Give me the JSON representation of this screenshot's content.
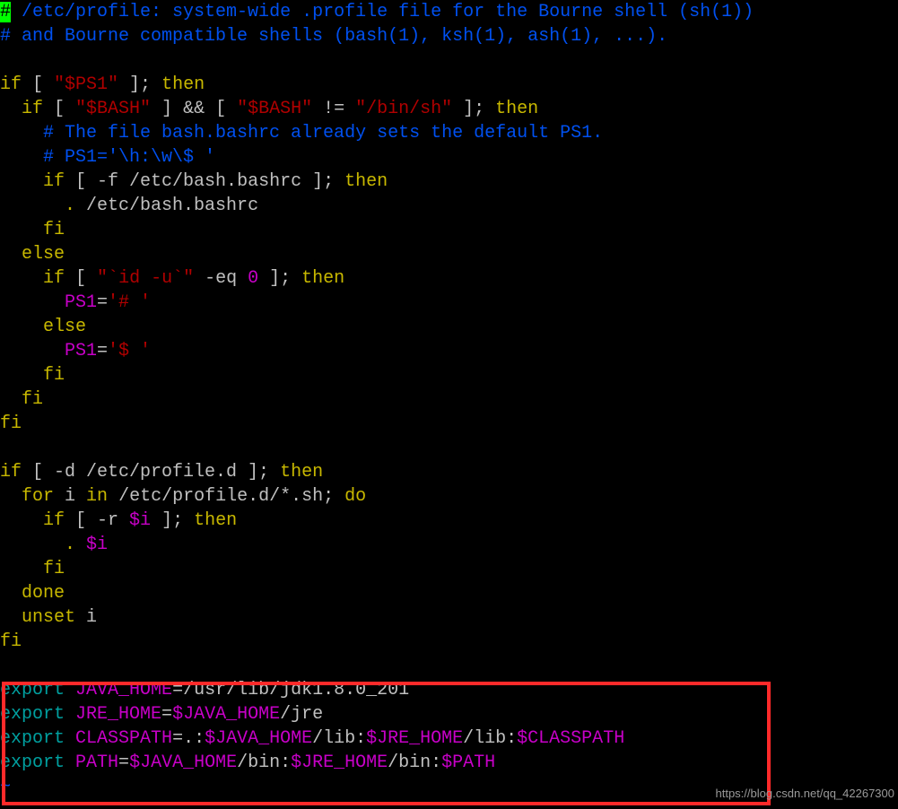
{
  "lines": {
    "l1_hash": "#",
    "l1_rest": " /etc/profile: system-wide .profile file for the Bourne shell (sh(1))",
    "l2": "# and Bourne compatible shells (bash(1), ksh(1), ash(1), ...).",
    "l3": "",
    "l4_if": "if",
    "l4_a": " [ ",
    "l4_ps1": "\"$PS1\"",
    "l4_b": " ]; ",
    "l4_then": "then",
    "l5_pad": "  ",
    "l5_if": "if",
    "l5_a": " [ ",
    "l5_bash1": "\"$BASH\"",
    "l5_b": " ] && [ ",
    "l5_bash2": "\"$BASH\"",
    "l5_c": " != ",
    "l5_binsh": "\"/bin/sh\"",
    "l5_d": " ]; ",
    "l5_then": "then",
    "l6": "    # The file bash.bashrc already sets the default PS1.",
    "l7": "    # PS1='\\h:\\w\\$ '",
    "l8_pad": "    ",
    "l8_if": "if",
    "l8_a": " [ -f /etc/bash.bashrc ]; ",
    "l8_then": "then",
    "l9_pad": "      ",
    "l9_dot": ".",
    "l9_a": " /etc/bash.bashrc",
    "l10_pad": "    ",
    "l10_fi": "fi",
    "l11_pad": "  ",
    "l11_else": "else",
    "l12_pad": "    ",
    "l12_if": "if",
    "l12_a": " [ ",
    "l12_q1": "\"",
    "l12_id": "`id -u`",
    "l12_q2": "\"",
    "l12_b": " -eq ",
    "l12_num": "0",
    "l12_c": " ]; ",
    "l12_then": "then",
    "l13_pad": "      ",
    "l13_ps1": "PS1",
    "l13_eq": "=",
    "l13_val": "'# '",
    "l14_pad": "    ",
    "l14_else": "else",
    "l15_pad": "      ",
    "l15_ps1": "PS1",
    "l15_eq": "=",
    "l15_val": "'$ '",
    "l16_pad": "    ",
    "l16_fi": "fi",
    "l17_pad": "  ",
    "l17_fi": "fi",
    "l18_fi": "fi",
    "l19": "",
    "l20_if": "if",
    "l20_a": " [ -d /etc/profile.d ]; ",
    "l20_then": "then",
    "l21_pad": "  ",
    "l21_for": "for",
    "l21_a": " i ",
    "l21_in": "in",
    "l21_b": " /etc/profile.d/*.sh; ",
    "l21_do": "do",
    "l22_pad": "    ",
    "l22_if": "if",
    "l22_a": " [ -r ",
    "l22_i": "$i",
    "l22_b": " ]; ",
    "l22_then": "then",
    "l23_pad": "      ",
    "l23_dot": ".",
    "l23_sp": " ",
    "l23_i": "$i",
    "l24_pad": "    ",
    "l24_fi": "fi",
    "l25_pad": "  ",
    "l25_done": "done",
    "l26_pad": "  ",
    "l26_unset": "unset",
    "l26_a": " i",
    "l27_fi": "fi",
    "l28": "",
    "l29_exp": "export",
    "l29_a": " ",
    "l29_var": "JAVA_HOME",
    "l29_eq": "=/usr/lib/jdk1.8.0_201",
    "l30_exp": "export",
    "l30_a": " ",
    "l30_var": "JRE_HOME",
    "l30_eq": "=",
    "l30_jh": "$JAVA_HOME",
    "l30_b": "/jre",
    "l31_exp": "export",
    "l31_a": " ",
    "l31_var": "CLASSPATH",
    "l31_eq": "=.:",
    "l31_jh": "$JAVA_HOME",
    "l31_b": "/lib:",
    "l31_jre": "$JRE_HOME",
    "l31_c": "/lib:",
    "l31_cp": "$CLASSPATH",
    "l32_exp": "export",
    "l32_a": " ",
    "l32_var": "PATH",
    "l32_eq": "=",
    "l32_jh": "$JAVA_HOME",
    "l32_b": "/bin:",
    "l32_jre": "$JRE_HOME",
    "l32_c": "/bin:",
    "l32_path": "$PATH",
    "tilde": "~"
  },
  "watermark": "https://blog.csdn.net/qq_42267300"
}
